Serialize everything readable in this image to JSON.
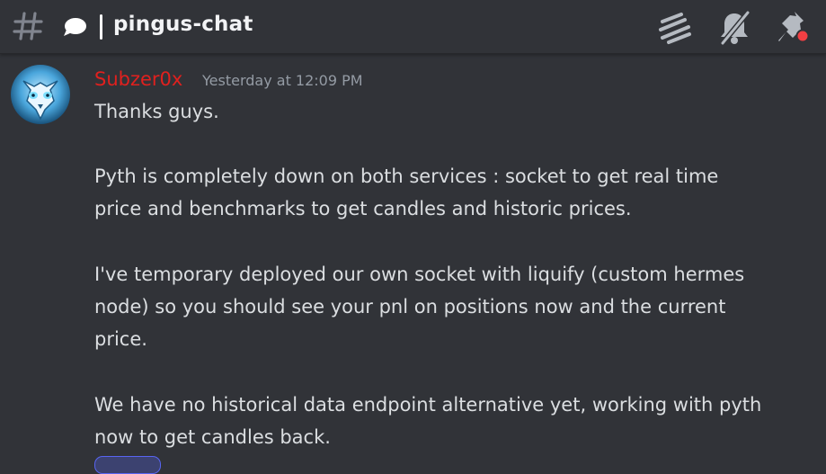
{
  "header": {
    "channel_name": "pingus-chat",
    "icons": [
      "hash-icon",
      "thread-bubble-icon",
      "threads-icon",
      "bell-muted-icon",
      "pin-icon"
    ],
    "colors": {
      "background": "#313338",
      "notification_dot": "#f23f43"
    }
  },
  "message": {
    "author": "Subzer0x",
    "author_color": "#e0201e",
    "timestamp": "Yesterday at 12:09 PM",
    "lines": [
      "Thanks guys.",
      "Pyth is completely down on both services : socket to get real time",
      "price and benchmarks to get candles and historic prices.",
      "I've temporary deployed our own socket with liquify (custom hermes",
      "node) so you should see your pnl on positions now and the current",
      "price.",
      "We have no historical data endpoint alternative yet, working with pyth",
      "now to get candles back."
    ]
  }
}
